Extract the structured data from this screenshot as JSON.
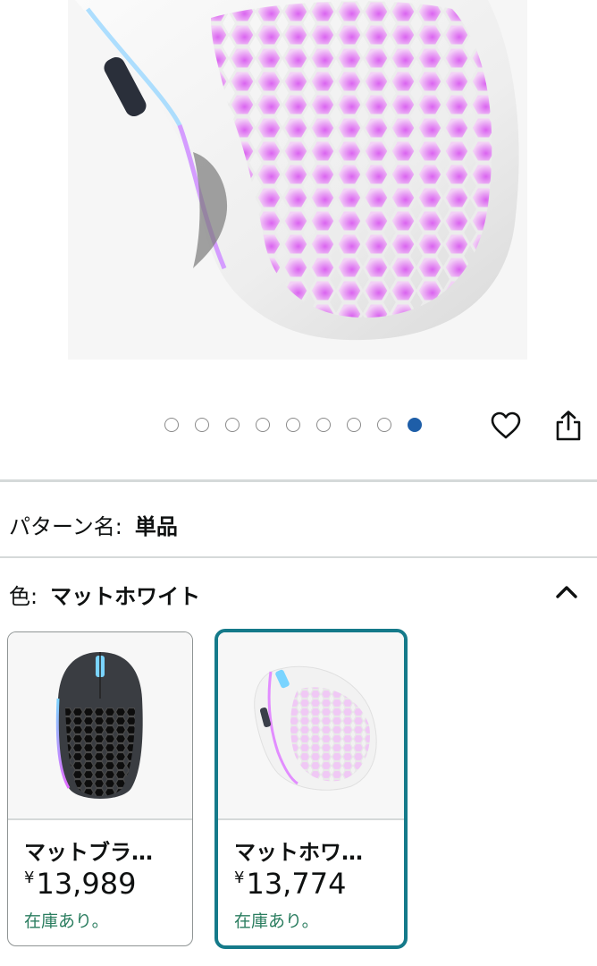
{
  "gallery": {
    "image_count": 9,
    "active_index": 8,
    "main_image": "white-honeycomb-mouse-photo",
    "icons": {
      "wishlist": "heart-icon",
      "share": "share-icon"
    }
  },
  "pattern": {
    "label": "パターン名:",
    "value": "単品"
  },
  "color": {
    "label": "色:",
    "value": "マットホワイト",
    "toggle_icon": "chevron-up-icon"
  },
  "options": [
    {
      "name": "マットブラ…",
      "currency": "¥",
      "price": "13,989",
      "stock": "在庫あり。",
      "selected": false,
      "image": "black-honeycomb-mouse-thumbnail"
    },
    {
      "name": "マットホワ…",
      "currency": "¥",
      "price": "13,774",
      "stock": "在庫あり。",
      "selected": true,
      "image": "white-honeycomb-mouse-thumbnail"
    }
  ],
  "colors": {
    "active_dot": "#1e5ea8",
    "selected_border": "#157a8a",
    "in_stock": "#2a7d5f",
    "divider": "#d5d9d9"
  }
}
